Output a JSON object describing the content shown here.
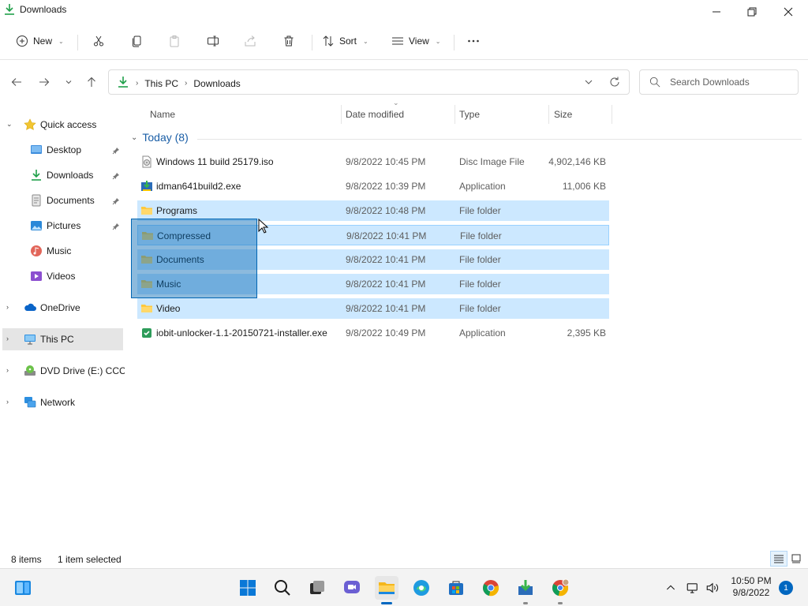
{
  "window": {
    "title": "Downloads"
  },
  "toolbar": {
    "new_label": "New",
    "sort_label": "Sort",
    "view_label": "View"
  },
  "address": {
    "crumbs": [
      "This PC",
      "Downloads"
    ]
  },
  "search": {
    "placeholder": "Search Downloads"
  },
  "sidebar": {
    "items": [
      {
        "label": "Quick access",
        "icon": "star-icon"
      },
      {
        "label": "Desktop",
        "icon": "desktop-icon"
      },
      {
        "label": "Downloads",
        "icon": "download-icon"
      },
      {
        "label": "Documents",
        "icon": "document-icon"
      },
      {
        "label": "Pictures",
        "icon": "pictures-icon"
      },
      {
        "label": "Music",
        "icon": "music-icon"
      },
      {
        "label": "Videos",
        "icon": "videos-icon"
      },
      {
        "label": "OneDrive",
        "icon": "cloud-icon"
      },
      {
        "label": "This PC",
        "icon": "computer-icon"
      },
      {
        "label": "DVD Drive (E:) CCCC",
        "icon": "dvd-drive-icon"
      },
      {
        "label": "Network",
        "icon": "network-icon"
      }
    ]
  },
  "columns": {
    "name": "Name",
    "date": "Date modified",
    "type": "Type",
    "size": "Size"
  },
  "group": {
    "label": "Today (8)"
  },
  "files": [
    {
      "name": "Windows 11 build 25179.iso",
      "date": "9/8/2022 10:45 PM",
      "type": "Disc Image File",
      "size": "4,902,146 KB",
      "icon": "iso-file-icon"
    },
    {
      "name": "idman641build2.exe",
      "date": "9/8/2022 10:39 PM",
      "type": "Application",
      "size": "11,006 KB",
      "icon": "app-exe-icon"
    },
    {
      "name": "Programs",
      "date": "9/8/2022 10:48 PM",
      "type": "File folder",
      "size": "",
      "icon": "folder-icon"
    },
    {
      "name": "Compressed",
      "date": "9/8/2022 10:41 PM",
      "type": "File folder",
      "size": "",
      "icon": "folder-icon"
    },
    {
      "name": "Documents",
      "date": "9/8/2022 10:41 PM",
      "type": "File folder",
      "size": "",
      "icon": "folder-icon"
    },
    {
      "name": "Music",
      "date": "9/8/2022 10:41 PM",
      "type": "File folder",
      "size": "",
      "icon": "folder-icon"
    },
    {
      "name": "Video",
      "date": "9/8/2022 10:41 PM",
      "type": "File folder",
      "size": "",
      "icon": "folder-icon"
    },
    {
      "name": "iobit-unlocker-1.1-20150721-installer.exe",
      "date": "9/8/2022 10:49 PM",
      "type": "Application",
      "size": "2,395 KB",
      "icon": "installer-exe-icon"
    }
  ],
  "status": {
    "items": "8 items",
    "selected": "1 item selected"
  },
  "taskbar": {
    "time": "10:50 PM",
    "date": "9/8/2022",
    "notifications": "1"
  },
  "colors": {
    "accent": "#0067c0",
    "selection": "#cce8ff",
    "folder": "#ffc83d"
  }
}
